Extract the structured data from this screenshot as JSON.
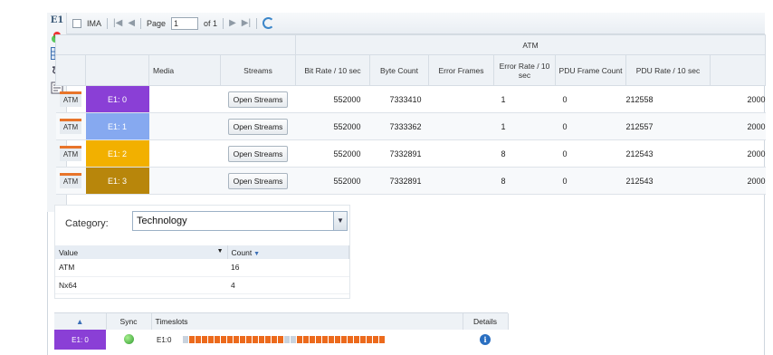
{
  "left_rail": {
    "title": "E1",
    "icons": [
      "color-wheel-icon",
      "grid-icon",
      "wave-icon",
      "list-icon"
    ]
  },
  "toolbar": {
    "checkbox_label": "IMA",
    "page_label": "Page",
    "page_value": "1",
    "of_label": "of 1",
    "refresh_icon": "refresh-icon"
  },
  "grid": {
    "group_header": "ATM",
    "columns": {
      "media": "Media",
      "streams": "Streams",
      "bit_rate": "Bit Rate / 10 sec",
      "byte_count": "Byte Count",
      "error_frames": "Error Frames",
      "error_rate": "Error Rate / 10 sec",
      "pdu_frame_count": "PDU Frame Count",
      "pdu_rate": "PDU Rate / 10 sec"
    },
    "rows": [
      {
        "proto": "ATM",
        "e1": "E1: 0",
        "color": "#8a3fd6",
        "button": "Open Streams",
        "bit_rate": "552000",
        "byte_count": "7333410",
        "error_frames": "1",
        "error_rate": "0",
        "pdu_frame_count": "212558",
        "pdu_rate": "2000"
      },
      {
        "proto": "ATM",
        "e1": "E1: 1",
        "color": "#86a9f0",
        "button": "Open Streams",
        "bit_rate": "552000",
        "byte_count": "7333362",
        "error_frames": "1",
        "error_rate": "0",
        "pdu_frame_count": "212557",
        "pdu_rate": "2000"
      },
      {
        "proto": "ATM",
        "e1": "E1: 2",
        "color": "#f2b000",
        "button": "Open Streams",
        "bit_rate": "552000",
        "byte_count": "7332891",
        "error_frames": "8",
        "error_rate": "0",
        "pdu_frame_count": "212543",
        "pdu_rate": "2000"
      },
      {
        "proto": "ATM",
        "e1": "E1: 3",
        "color": "#b8860b",
        "button": "Open Streams",
        "bit_rate": "552000",
        "byte_count": "7332891",
        "error_frames": "8",
        "error_rate": "0",
        "pdu_frame_count": "212543",
        "pdu_rate": "2000"
      }
    ]
  },
  "category": {
    "label": "Category:",
    "selected": "Technology",
    "columns": {
      "value": "Value",
      "count": "Count"
    },
    "rows": [
      {
        "value": "ATM",
        "count": "16"
      },
      {
        "value": "Nx64",
        "count": "4"
      }
    ]
  },
  "timeslots": {
    "columns": {
      "sort": "▲",
      "sync": "Sync",
      "timeslots": "Timeslots",
      "details": "Details"
    },
    "row": {
      "e1": "E1: 0",
      "color": "#8a3fd6",
      "label": "E1:0",
      "sync_color": "#3bb53b"
    }
  }
}
